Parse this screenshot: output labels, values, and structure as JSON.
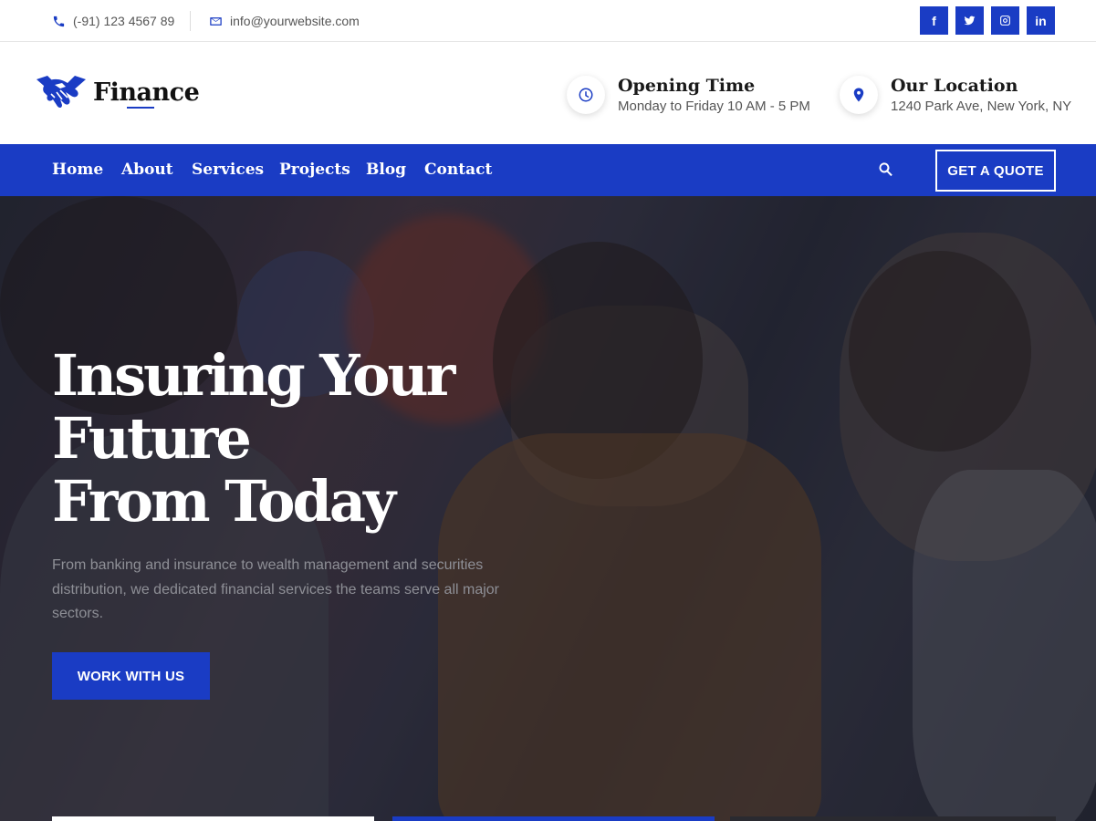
{
  "topbar": {
    "phone": "(-91) 123 4567 89",
    "email": "info@yourwebsite.com",
    "social": [
      "f",
      "twitter-icon",
      "instagram-icon",
      "in"
    ]
  },
  "header": {
    "brand": "Finance",
    "opening": {
      "title": "Opening Time",
      "value": "Monday to Friday 10 AM - 5 PM"
    },
    "location": {
      "title": "Our Location",
      "value": "1240 Park Ave, New York, NY"
    }
  },
  "nav": {
    "items": [
      "Home",
      "About",
      "Services",
      "Projects",
      "Blog",
      "Contact"
    ],
    "quote": "GET A QUOTE"
  },
  "hero": {
    "heading": [
      "Insuring Your",
      "Future",
      "From Today"
    ],
    "text": "From banking and insurance to wealth management and securities distribution, we dedicated financial services the teams serve all major sectors.",
    "cta": "WORK WITH US"
  },
  "colors": {
    "brand": "#1a3cc4",
    "white": "#ffffff"
  }
}
